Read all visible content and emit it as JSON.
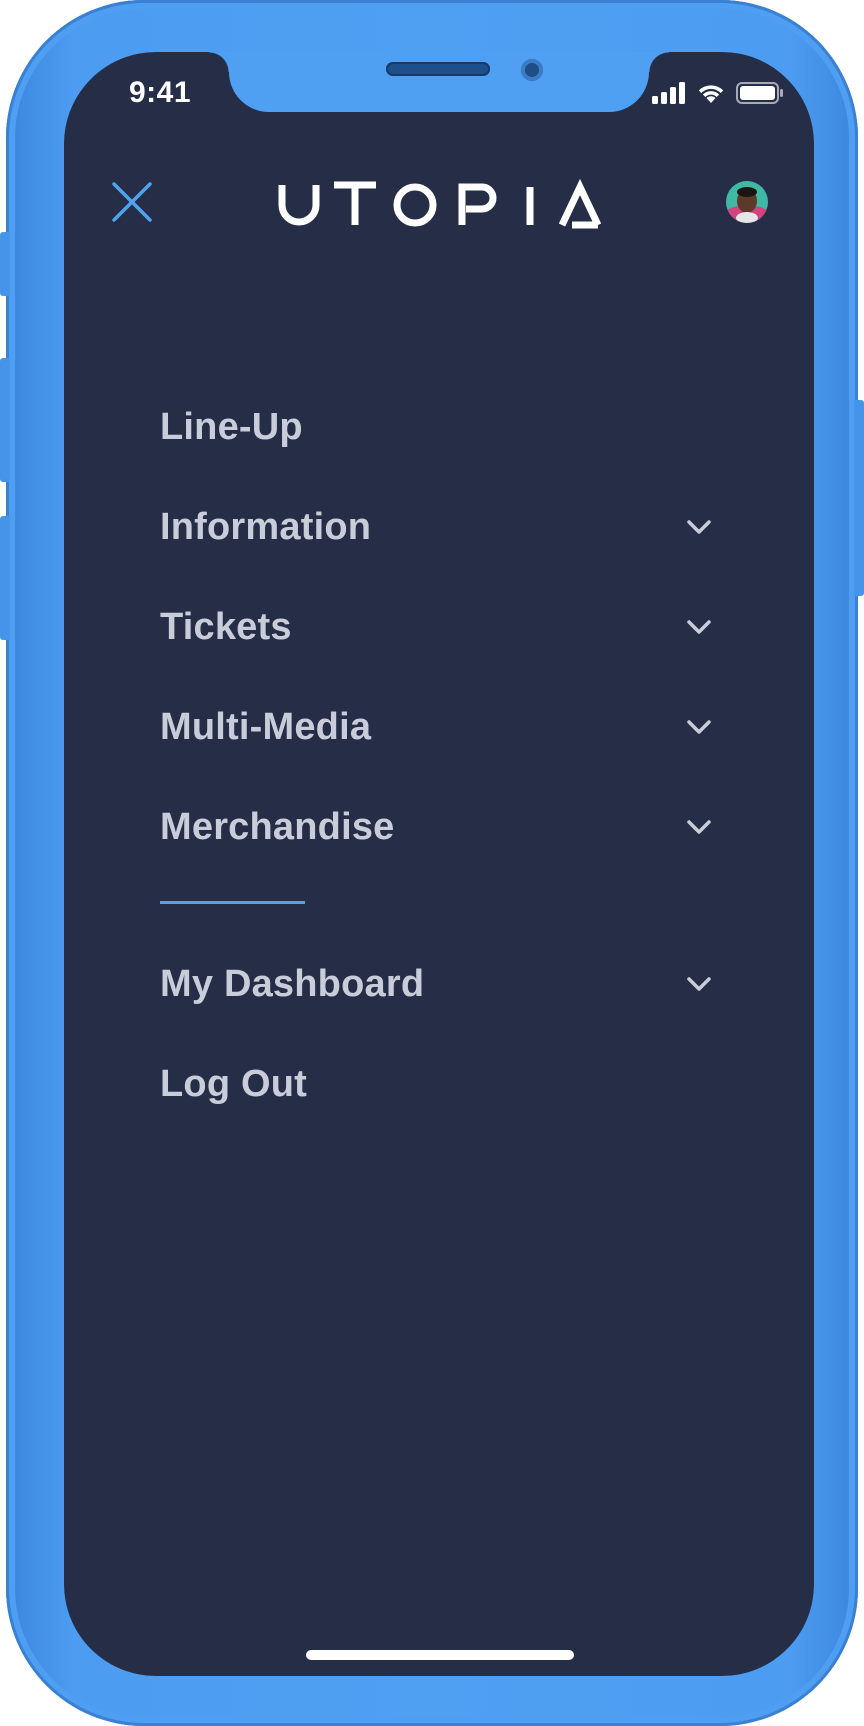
{
  "status_bar": {
    "time": "9:41"
  },
  "header": {
    "close_icon": "close-icon",
    "logo_text": "UTOPIA",
    "avatar_icon": "user-avatar"
  },
  "menu": {
    "items": [
      {
        "label": "Line-Up",
        "expandable": false
      },
      {
        "label": "Information",
        "expandable": true
      },
      {
        "label": "Tickets",
        "expandable": true
      },
      {
        "label": "Multi-Media",
        "expandable": true
      },
      {
        "label": "Merchandise",
        "expandable": true
      }
    ],
    "secondary_items": [
      {
        "label": "My Dashboard",
        "expandable": true
      },
      {
        "label": "Log Out",
        "expandable": false
      }
    ]
  },
  "colors": {
    "device_frame": "#4f9ff3",
    "screen_background": "#252d47",
    "accent": "#4fa3ee",
    "menu_text": "#c9cdd9"
  }
}
